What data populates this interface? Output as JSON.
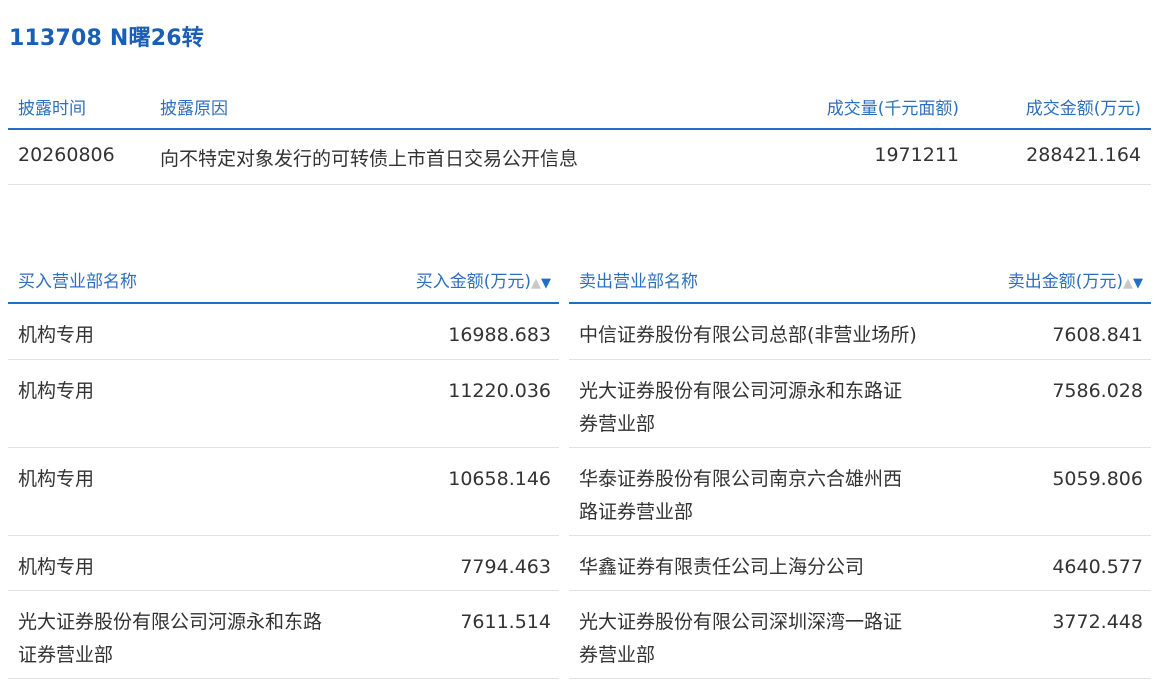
{
  "title": "113708 N曙26转",
  "disclosure": {
    "headers": {
      "date": "披露时间",
      "reason": "披露原因",
      "volume": "成交量(千元面额)",
      "amount": "成交金额(万元)"
    },
    "row": {
      "date": "20260806",
      "reason": "向不特定对象发行的可转债上市首日交易公开信息",
      "volume": "1971211",
      "amount": "288421.164"
    }
  },
  "buy": {
    "header_name": "买入营业部名称",
    "header_amount": "买入金额(万元)",
    "rows": [
      {
        "line1": "机构专用",
        "line2": "",
        "amount": "16988.683"
      },
      {
        "line1": "机构专用",
        "line2": "",
        "amount": "11220.036"
      },
      {
        "line1": "机构专用",
        "line2": "",
        "amount": "10658.146"
      },
      {
        "line1": "机构专用",
        "line2": "",
        "amount": "7794.463"
      },
      {
        "line1": "光大证券股份有限公司河源永和东路",
        "line2": "证券营业部",
        "amount": "7611.514"
      }
    ]
  },
  "sell": {
    "header_name": "卖出营业部名称",
    "header_amount": "卖出金额(万元)",
    "rows": [
      {
        "line1": "中信证券股份有限公司总部(非营业场所)",
        "line2": "",
        "amount": "7608.841"
      },
      {
        "line1": "光大证券股份有限公司河源永和东路证",
        "line2": "券营业部",
        "amount": "7586.028"
      },
      {
        "line1": "华泰证券股份有限公司南京六合雄州西",
        "line2": "路证券营业部",
        "amount": "5059.806"
      },
      {
        "line1": "华鑫证券有限责任公司上海分公司",
        "line2": "",
        "amount": "4640.577"
      },
      {
        "line1": "光大证券股份有限公司深圳深湾一路证",
        "line2": "券营业部",
        "amount": "3772.448"
      }
    ]
  },
  "sort_icons": {
    "up": "▲",
    "down": "▼"
  },
  "colors": {
    "accent": "#1f6fc5",
    "title": "#1a5eb5",
    "header_text": "#2d6fbf"
  }
}
